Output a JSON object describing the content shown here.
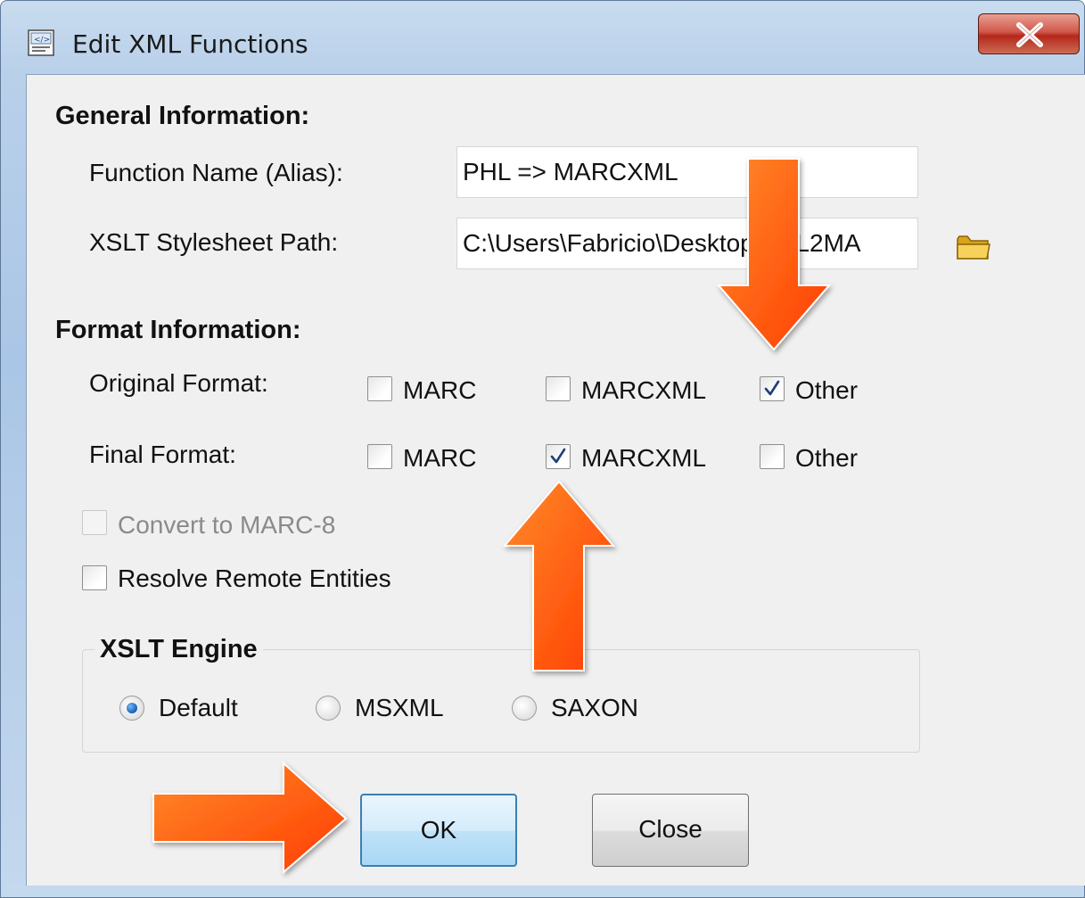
{
  "window": {
    "title": "Edit XML Functions",
    "close_label": "X"
  },
  "general": {
    "section_title": "General Information:",
    "function_name_label": "Function Name (Alias):",
    "function_name_value": "PHL => MARCXML",
    "xslt_path_label": "XSLT Stylesheet Path:",
    "xslt_path_value": "C:\\Users\\Fabricio\\Desktop\\PHL2MA"
  },
  "format": {
    "section_title": "Format Information:",
    "original_label": "Original Format:",
    "final_label": "Final Format:",
    "original_options": [
      {
        "label": "MARC",
        "checked": false
      },
      {
        "label": "MARCXML",
        "checked": false
      },
      {
        "label": "Other",
        "checked": true
      }
    ],
    "final_options": [
      {
        "label": "MARC",
        "checked": false
      },
      {
        "label": "MARCXML",
        "checked": true
      },
      {
        "label": "Other",
        "checked": false
      }
    ]
  },
  "options": {
    "convert_marc8_label": "Convert to MARC-8",
    "convert_marc8_enabled": false,
    "convert_marc8_checked": false,
    "resolve_entities_label": "Resolve Remote Entities",
    "resolve_entities_checked": false
  },
  "engine": {
    "group_title": "XSLT Engine",
    "options": [
      {
        "label": "Default",
        "selected": true
      },
      {
        "label": "MSXML",
        "selected": false
      },
      {
        "label": "SAXON",
        "selected": false
      }
    ]
  },
  "buttons": {
    "ok_label": "OK",
    "close_label": "Close"
  },
  "colors": {
    "highlight_arrow": "#ff5a14",
    "title_close": "#c8392b",
    "ok_border": "#3c7fb1",
    "radio_dot": "#1e6bc4"
  },
  "icons": {
    "title_icon": "xml-window-icon",
    "browse_icon": "folder-icon"
  }
}
